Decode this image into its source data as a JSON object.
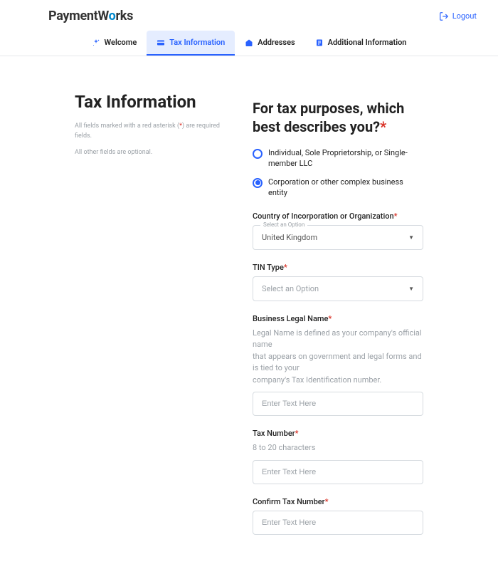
{
  "header": {
    "logo_part1": "PaymentW",
    "logo_o": "o",
    "logo_part2": "rks",
    "logout": "Logout"
  },
  "tabs": {
    "welcome": "Welcome",
    "tax": "Tax Information",
    "addresses": "Addresses",
    "additional": "Additional Information"
  },
  "sidebar": {
    "title": "Tax Information",
    "note1a": "All fields marked with a red asterisk (",
    "note1_ast": "*",
    "note1b": ") are required fields.",
    "note2": "All other fields are optional."
  },
  "form": {
    "question": "For tax purposes, which best describes you?",
    "option1": "Individual, Sole Proprietorship, or Single-member LLC",
    "option2": "Corporation or other complex business entity",
    "country_label": "Country of Incorporation or Organization",
    "select_option_float": "Select an Option",
    "country_value": "United Kingdom",
    "tin_type_label": "TIN Type",
    "tin_type_placeholder": "Select an Option",
    "business_legal_name_label": "Business Legal Name",
    "legal_help1": "Legal Name is defined as your company's official name",
    "legal_help2": "that appears on government and legal forms and is tied to your",
    "legal_help3": "company's Tax Identification number.",
    "enter_text_placeholder": "Enter Text Here",
    "tax_number_label": "Tax Number",
    "tax_number_help": "8 to 20 characters",
    "confirm_tax_label": "Confirm Tax Number"
  }
}
